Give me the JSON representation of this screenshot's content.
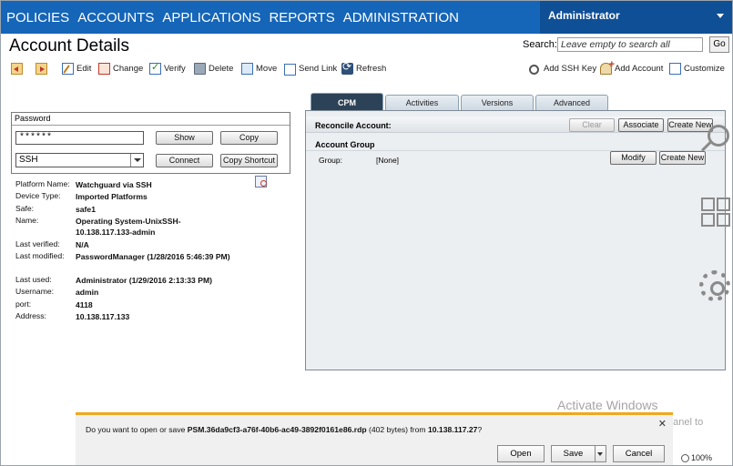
{
  "topnav": {
    "items": [
      "POLICIES",
      "ACCOUNTS",
      "APPLICATIONS",
      "REPORTS",
      "ADMINISTRATION"
    ],
    "active": "ACCOUNTS",
    "user": "Administrator"
  },
  "page": {
    "title": "Account Details",
    "search_label": "Search:",
    "search_placeholder": "Leave empty to search all",
    "go_label": "Go"
  },
  "toolbar": {
    "back_icon": "back-icon",
    "forward_icon": "forward-icon",
    "edit": "Edit",
    "change": "Change",
    "verify": "Verify",
    "delete": "Delete",
    "move": "Move",
    "send_link": "Send Link",
    "refresh": "Refresh",
    "add_ssh_key": "Add SSH Key",
    "add_account": "Add Account",
    "customize": "Customize"
  },
  "password_panel": {
    "header": "Password",
    "masked_value": "******",
    "show": "Show",
    "copy": "Copy",
    "connection_value": "SSH",
    "connect": "Connect",
    "copy_shortcut": "Copy Shortcut"
  },
  "details": [
    {
      "label": "Platform Name:",
      "value": "Watchguard via SSH"
    },
    {
      "label": "Device Type:",
      "value": "Imported Platforms"
    },
    {
      "label": "Safe:",
      "value": "safe1"
    },
    {
      "label": "Name:",
      "value": "Operating System-UnixSSH-10.138.117.133-admin"
    },
    {
      "label": "Last verified:",
      "value": "N/A"
    },
    {
      "label": "Last modified:",
      "value": "PasswordManager (1/28/2016 5:46:39 PM)"
    },
    {
      "label": "Last used:",
      "value": "Administrator (1/29/2016 2:13:33 PM)"
    },
    {
      "label": "Username:",
      "value": "admin"
    },
    {
      "label": "port:",
      "value": "4118"
    },
    {
      "label": "Address:",
      "value": "10.138.117.133"
    }
  ],
  "tabs": [
    "CPM",
    "Activities",
    "Versions",
    "Advanced"
  ],
  "cpm": {
    "reconcile_label": "Reconcile Account:",
    "clear": "Clear",
    "associate": "Associate",
    "create_new": "Create New",
    "account_group_header": "Account Group",
    "group_label": "Group:",
    "group_value": "[None]",
    "modify": "Modify",
    "create_new_2": "Create New"
  },
  "watermark": {
    "line1": "Activate Windows",
    "line2": "Go to System in Control Panel to activate Windows."
  },
  "download": {
    "prompt_prefix": "Do you want to open or save ",
    "filename": "PSM.36da9cf3-a76f-40b6-ac49-3892f0161e86.rdp",
    "size": " (402 bytes) from ",
    "host": "10.138.117.27",
    "suffix": "?",
    "open": "Open",
    "save": "Save",
    "cancel": "Cancel"
  },
  "zoom": "100%",
  "colors": {
    "nav": "#1565b8",
    "nav_user": "#0f4f96",
    "active_tab": "#2c4257",
    "download_accent": "#f0a81e"
  }
}
